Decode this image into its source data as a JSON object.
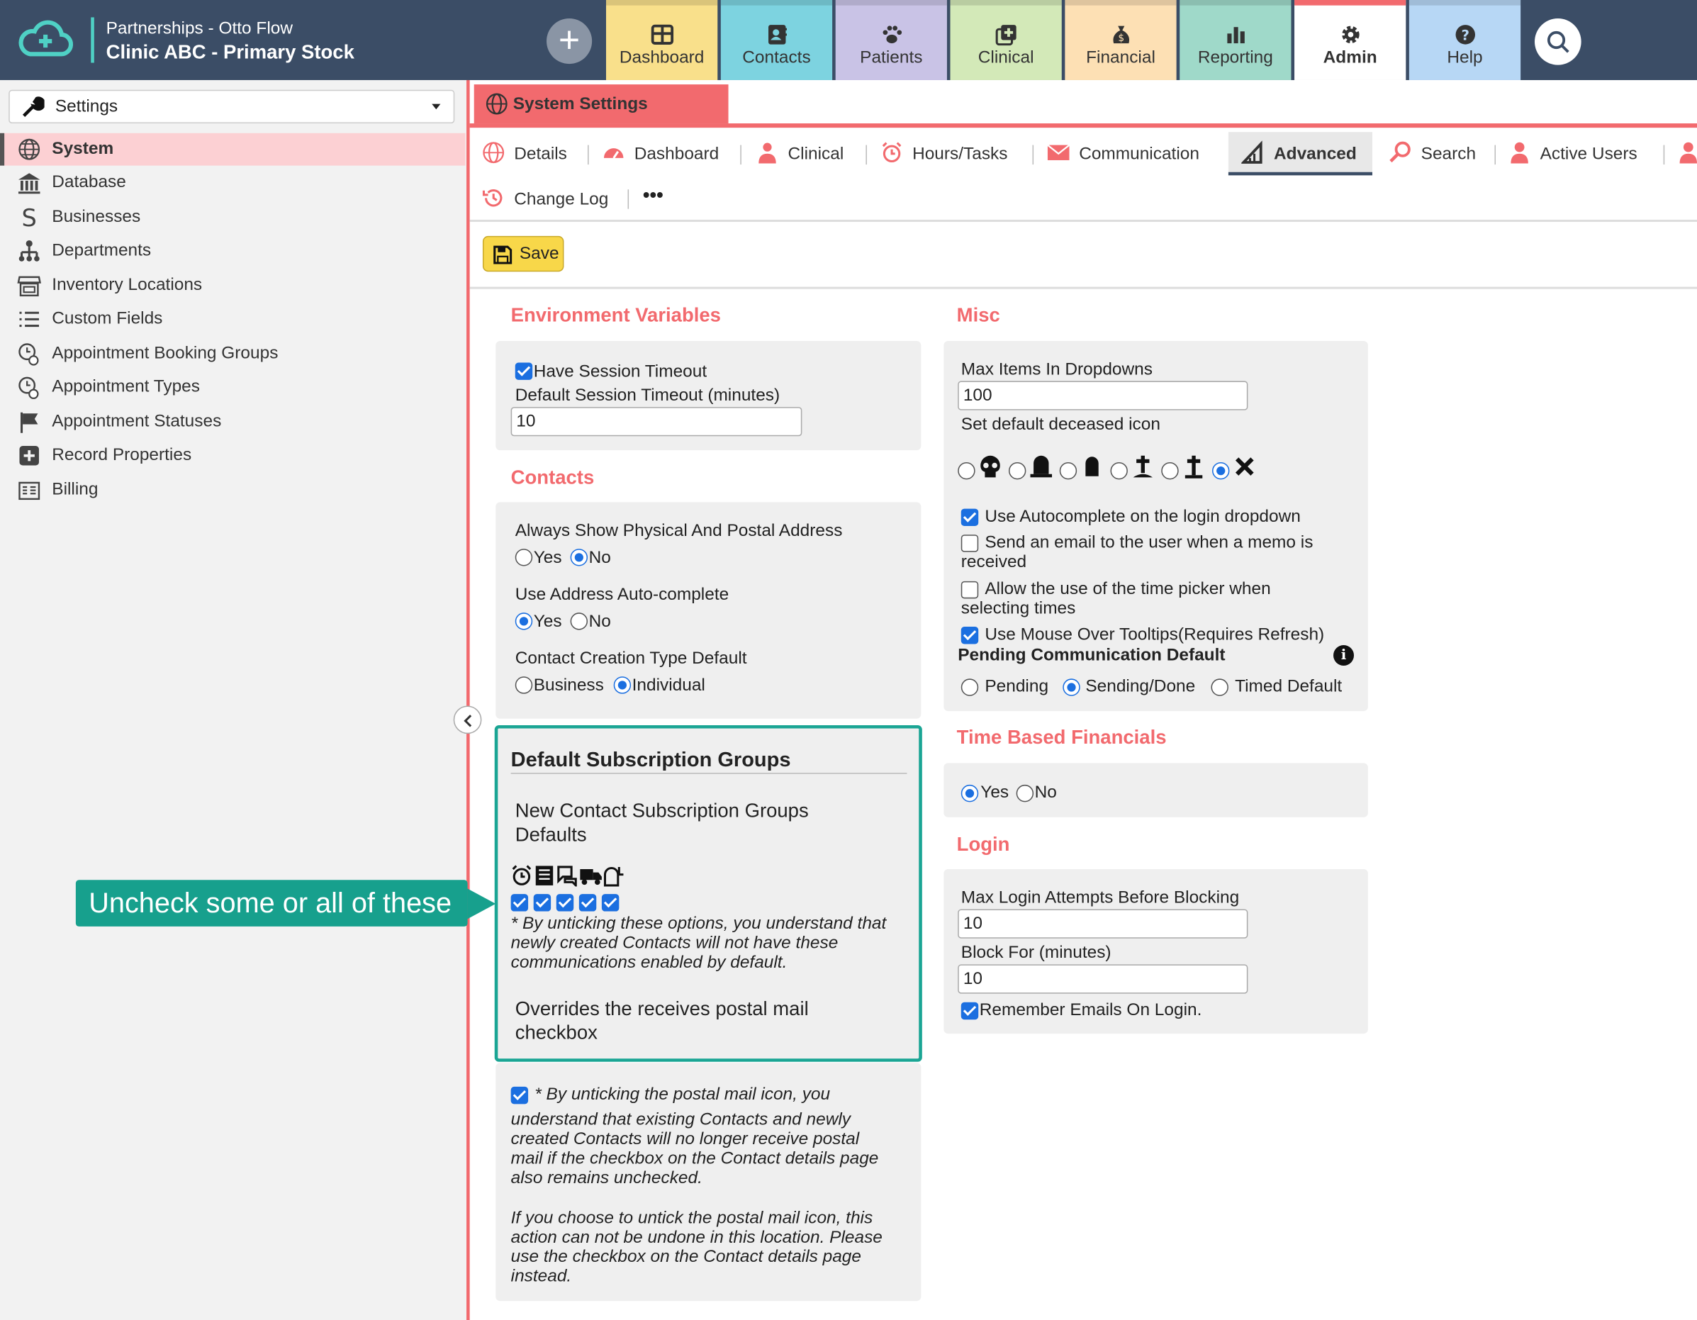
{
  "brand": {
    "line1": "Partnerships - Otto Flow",
    "line2": "Clinic ABC - Primary Stock"
  },
  "nav": {
    "add_label": "+",
    "tabs": [
      {
        "label": "Dashboard",
        "color": "#f9e08b",
        "icon": "dashboard-icon"
      },
      {
        "label": "Contacts",
        "color": "#7dd3e0",
        "icon": "contact-card-icon"
      },
      {
        "label": "Patients",
        "color": "#c9c3e6",
        "icon": "paw-icon"
      },
      {
        "label": "Clinical",
        "color": "#d3e9b8",
        "icon": "medical-plus-icon"
      },
      {
        "label": "Financial",
        "color": "#fde0b4",
        "icon": "money-bag-icon"
      },
      {
        "label": "Reporting",
        "color": "#9fd9c9",
        "icon": "bar-chart-icon"
      },
      {
        "label": "Admin",
        "color": "#ffffff",
        "icon": "gear-icon"
      },
      {
        "label": "Help",
        "color": "#b7d7f5",
        "icon": "help-icon"
      }
    ]
  },
  "sidebar": {
    "select_label": "Settings",
    "items": [
      {
        "label": "System",
        "icon": "globe-icon"
      },
      {
        "label": "Database",
        "icon": "bank-icon"
      },
      {
        "label": "Businesses",
        "icon": "dollar-icon"
      },
      {
        "label": "Departments",
        "icon": "org-chart-icon"
      },
      {
        "label": "Inventory Locations",
        "icon": "store-icon"
      },
      {
        "label": "Custom Fields",
        "icon": "list-icon"
      },
      {
        "label": "Appointment Booking Groups",
        "icon": "appointment-group-icon"
      },
      {
        "label": "Appointment Types",
        "icon": "appointment-type-icon"
      },
      {
        "label": "Appointment Statuses",
        "icon": "flag-icon"
      },
      {
        "label": "Record Properties",
        "icon": "plus-square-icon"
      },
      {
        "label": "Billing",
        "icon": "billing-icon"
      }
    ]
  },
  "page": {
    "title": "System Settings",
    "subtabs": [
      "Details",
      "Dashboard",
      "Clinical",
      "Hours/Tasks",
      "Communication",
      "Advanced",
      "Search",
      "Active Users"
    ],
    "subtabs2": [
      "Change Log",
      "•••"
    ],
    "save_label": "Save"
  },
  "env": {
    "title": "Environment Variables",
    "session_timeout_label": "Have Session Timeout",
    "session_timeout_checked": true,
    "default_timeout_label": "Default Session Timeout (minutes)",
    "default_timeout_value": "10"
  },
  "contacts": {
    "title": "Contacts",
    "q1": "Always Show Physical And Postal Address",
    "q1_opts": [
      "Yes",
      "No"
    ],
    "q1_selected": "No",
    "q2": "Use Address Auto-complete",
    "q2_opts": [
      "Yes",
      "No"
    ],
    "q2_selected": "Yes",
    "q3": "Contact Creation Type Default",
    "q3_opts": [
      "Business",
      "Individual"
    ],
    "q3_selected": "Individual"
  },
  "dsg": {
    "title": "Default Subscription Groups",
    "new_defaults_line1": "New Contact Subscription Groups",
    "new_defaults_line2": "Defaults",
    "channel_icons": [
      "alarm-clock-icon",
      "newspaper-icon",
      "chat-bubble-icon",
      "truck-icon",
      "mailbox-icon"
    ],
    "checks": [
      true,
      true,
      true,
      true,
      true
    ],
    "note_lines": [
      "* By unticking these options, you understand that",
      "newly created Contacts will not have these",
      "communications enabled by default."
    ],
    "override_line1": "Overrides the receives postal mail",
    "override_line2": "checkbox"
  },
  "postal": {
    "checked": true,
    "lines": [
      "* By unticking the postal mail icon, you",
      "understand that existing Contacts and newly",
      "created Contacts will no longer receive postal",
      "mail if the checkbox on the Contact details page",
      "also remains unchecked."
    ],
    "lines2": [
      "If you choose to untick the postal mail icon, this",
      "action can not be undone in this location. Please",
      "use the checkbox on the Contact details page",
      "instead."
    ]
  },
  "callout": {
    "text": "Uncheck some or all of these"
  },
  "misc": {
    "title": "Misc",
    "max_items_label": "Max Items In Dropdowns",
    "max_items_value": "100",
    "deceased_label": "Set default deceased icon",
    "deceased_icons": [
      "skull-icon",
      "headstone-icon",
      "tombstone-icon",
      "grave-cross-icon",
      "cross-icon",
      "x-mark-icon"
    ],
    "deceased_selected": 5,
    "opt1": "Use Autocomplete on the login dropdown",
    "opt1_checked": true,
    "opt2_line1": "Send an email to the user when a memo is",
    "opt2_line2": "received",
    "opt2_checked": false,
    "opt3_line1": "Allow the use of the time picker when",
    "opt3_line2": "selecting times",
    "opt3_checked": false,
    "opt4": "Use Mouse Over Tooltips(Requires Refresh)",
    "opt4_checked": true,
    "pending_label": "Pending Communication Default",
    "pending_opts": [
      "Pending",
      "Sending/Done",
      "Timed Default"
    ],
    "pending_selected": "Sending/Done"
  },
  "tbf": {
    "title": "Time Based Financials",
    "opts": [
      "Yes",
      "No"
    ],
    "selected": "Yes"
  },
  "login": {
    "title": "Login",
    "max_attempts_label": "Max Login Attempts Before Blocking",
    "max_attempts_value": "10",
    "block_for_label": "Block For (minutes)",
    "block_for_value": "10",
    "remember_label": "Remember Emails On Login.",
    "remember_checked": true
  }
}
